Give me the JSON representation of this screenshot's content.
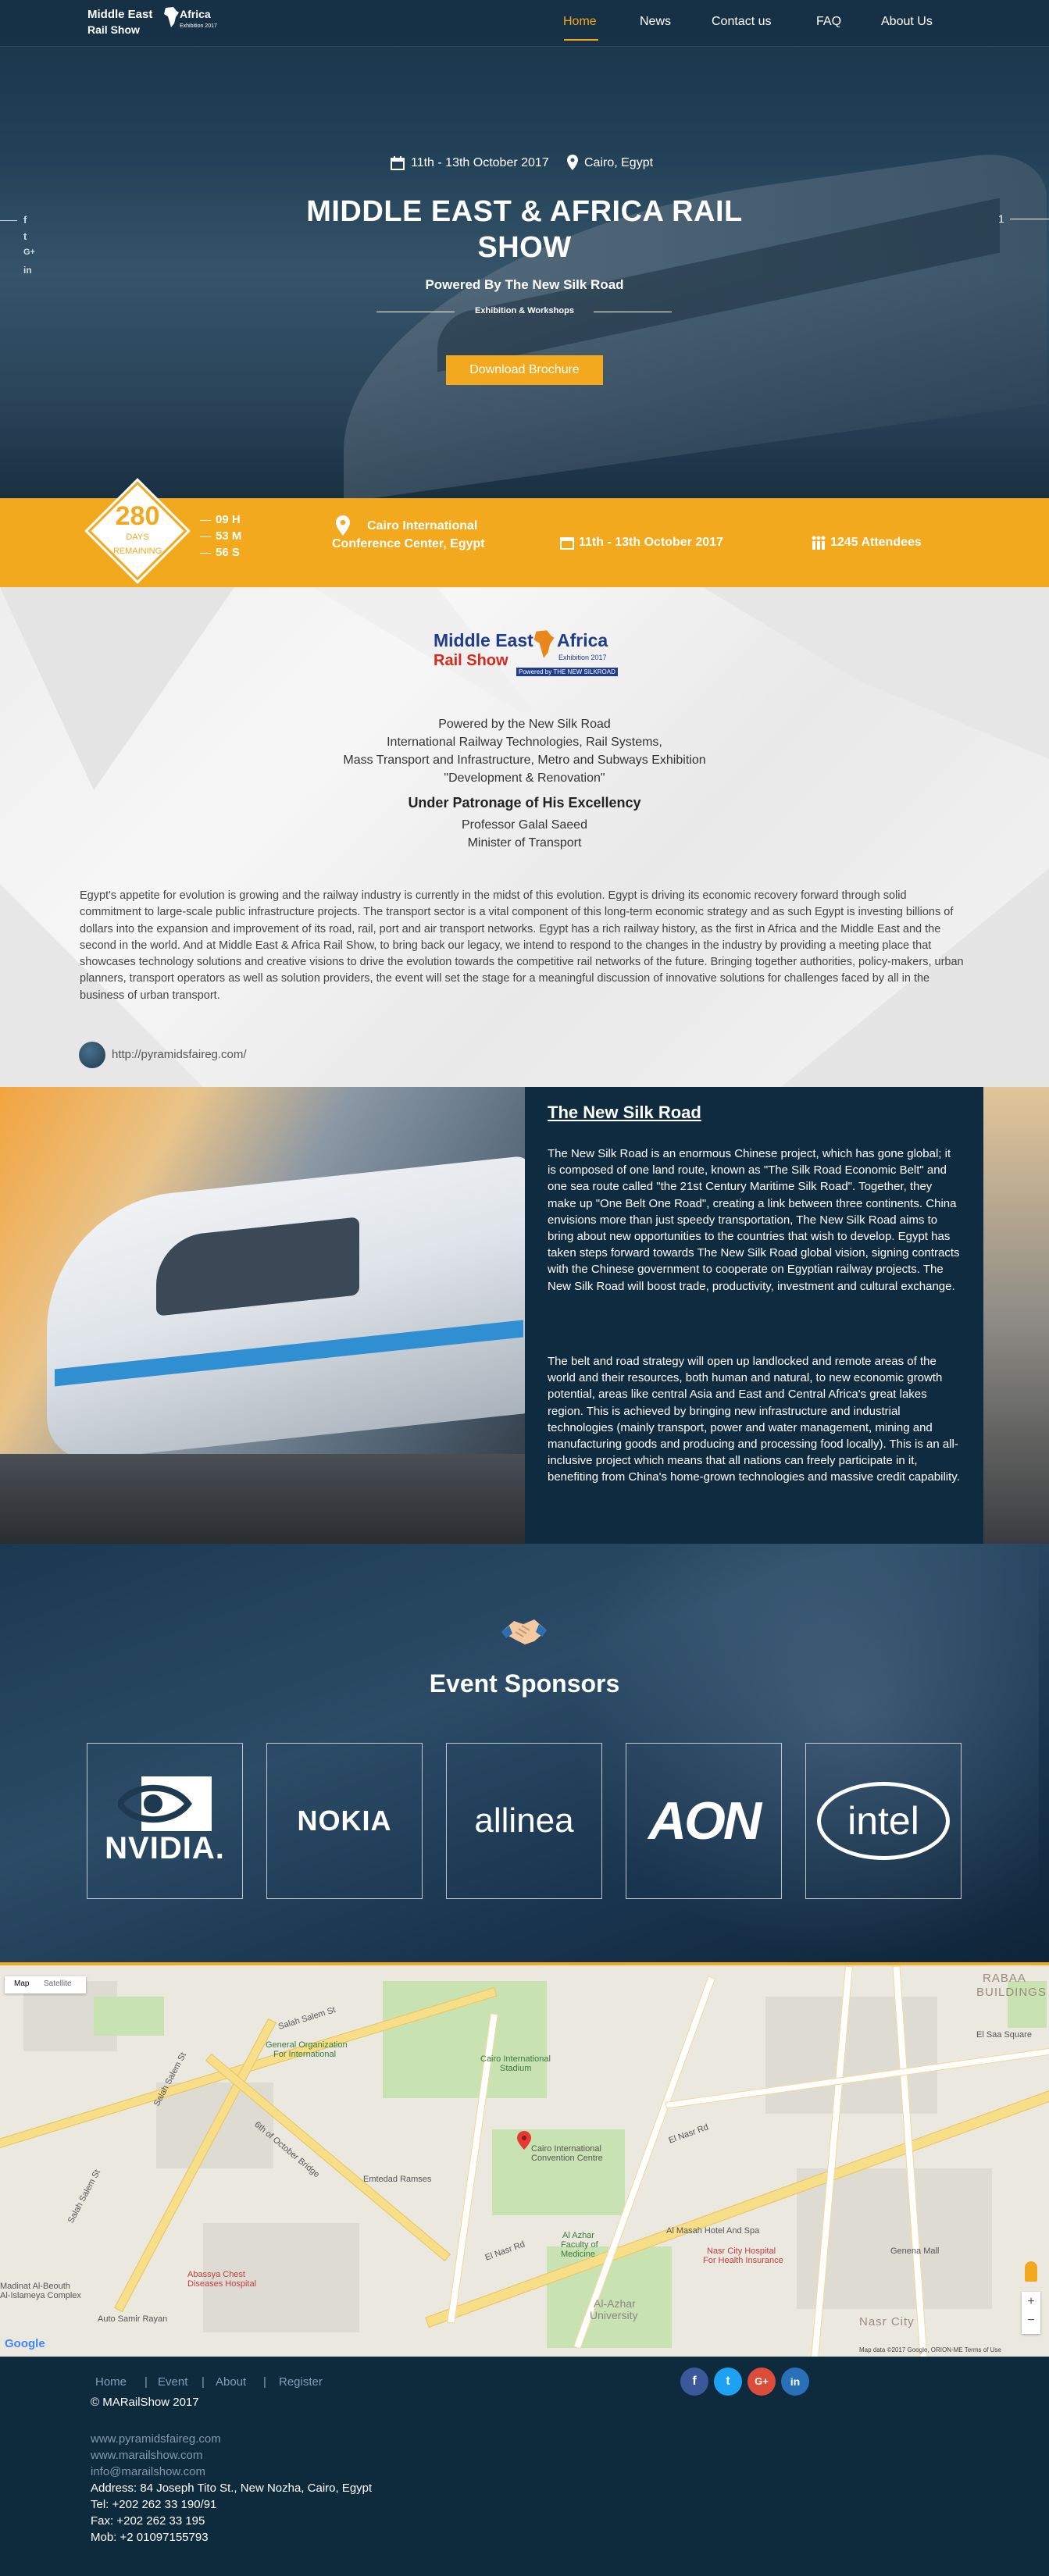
{
  "header": {
    "logo": {
      "line1": "Middle East",
      "line2": "Rail Show",
      "line3": "Africa",
      "line4": "Exhibition 2017"
    },
    "nav": [
      {
        "label": "Home",
        "active": true
      },
      {
        "label": "News"
      },
      {
        "label": "Contact us"
      },
      {
        "label": "FAQ"
      },
      {
        "label": "About Us"
      }
    ]
  },
  "hero": {
    "date": "11th - 13th October 2017",
    "location": "Cairo, Egypt",
    "title_line1": "MIDDLE EAST & AFRICA RAIL",
    "title_line2": "SHOW",
    "subtitle": "Powered By The New Silk Road",
    "exhibition": "Exhibition & Workshops",
    "button": "Download Brochure",
    "slide_number": "1",
    "social": [
      "f",
      "t",
      "G+",
      "in"
    ]
  },
  "info_bar": {
    "days": "280",
    "days_label1": "DAYS",
    "days_label2": "REMAINING",
    "hours": "09 H",
    "minutes": "53 M",
    "seconds": "56 S",
    "venue_line1": "Cairo International",
    "venue_line2": "Conference Center, Egypt",
    "date": "11th - 13th October 2017",
    "attendees": "1245 Attendees"
  },
  "about": {
    "logo": {
      "line1": "Middle East",
      "line2": "Rail Show",
      "line3": "Africa",
      "line4": "Exhibition 2017",
      "line5": "Powered by THE NEW SILKROAD"
    },
    "lines": [
      "Powered by the New Silk Road",
      "International Railway Technologies, Rail Systems,",
      "Mass Transport and Infrastructure, Metro and Subways Exhibition",
      "\"Development & Renovation\""
    ],
    "patronage": "Under Patronage of His Excellency",
    "person": "Professor Galal Saeed",
    "role": "Minister of Transport",
    "paragraph": "Egypt's appetite for evolution is growing and the railway industry is currently in the midst of this evolution. Egypt is driving its economic recovery forward through solid commitment to large-scale public infrastructure projects. The transport sector is a vital component of this long-term economic strategy and as such Egypt is investing billions of dollars into the expansion and improvement of its road, rail, port and air transport networks. Egypt has a rich railway history, as the first in Africa and the Middle East and the second in the world. And at Middle East & Africa Rail Show, to bring back our legacy, we intend to respond to the changes in the industry by providing a meeting place that showcases technology solutions and creative visions to drive the evolution towards the competitive rail networks of the future. Bringing together authorities, policy-makers, urban planners, transport operators as well as solution providers, the event will set the stage for a meaningful discussion of innovative solutions for challenges faced by all in the business of urban transport.",
    "link": "http://pyramidsfaireg.com/"
  },
  "silk_road": {
    "title": "The New Silk Road",
    "p1": "The New Silk Road is an enormous Chinese project, which has gone global; it is composed of one land route, known as \"The Silk Road Economic Belt\" and one sea route called \"the 21st Century Maritime Silk Road\". Together, they make up \"One Belt One Road\", creating a link between three continents. China envisions more than just speedy transportation, The New Silk Road aims to bring about new opportunities to the countries that wish to develop. Egypt has taken steps forward towards The New Silk Road global vision, signing contracts with the Chinese government to cooperate on Egyptian railway projects. The New Silk Road will boost trade, productivity, investment and cultural exchange.",
    "p2": "The belt and road strategy will open up landlocked and remote areas of the world and their resources, both human and natural, to new economic growth potential, areas like central Asia and East and Central Africa's great lakes region. This is achieved by bringing new infrastructure and industrial technologies (mainly transport, power and water management, mining and manufacturing goods and producing and processing food locally). This is an all-inclusive project which means that all nations can freely participate in it, benefiting from China's home-grown technologies and massive credit capability."
  },
  "sponsors": {
    "title": "Event Sponsors",
    "items": [
      "NVIDIA.",
      "NOKIA",
      "allinea",
      "AON",
      "intel"
    ]
  },
  "map": {
    "type_map": "Map",
    "type_satellite": "Satellite",
    "labels": {
      "salah1": "Salah Salem St",
      "salah2": "Salah Salem St",
      "salah3": "Salah Salem St",
      "org": "General Organization",
      "org2": "For International",
      "stadium": "Cairo International",
      "stadium2": "Stadium",
      "convention": "Cairo International",
      "convention2": "Convention Centre",
      "nasr": "El Nasr Rd",
      "nasr2": "El Nasr Rd",
      "oct": "6th of October Bridge",
      "emtedad": "Emtedad Ramses",
      "azhar": "Al Azhar",
      "azhar2": "Faculty of",
      "azhar3": "Medicine",
      "azharu": "Al-Azhar",
      "azharu2": "University",
      "masah": "Al Masah Hotel And Spa",
      "ncity": "Nasr City Hospital",
      "ncity2": "For Health Insurance",
      "abassya": "Abassya Chest",
      "abassya2": "Diseases Hospital",
      "nasrcity": "Nasr City",
      "rabaa": "RABAA",
      "rabaa2": "BUILDINGS",
      "elsaa": "El Saa Square",
      "genena": "Genena Mall",
      "madinat": "Madinat Al-Beouth",
      "madinat2": "Al-Islameya Complex",
      "auto": "Auto Samir Rayan",
      "google": "Google",
      "footer": "Map data ©2017 Google, ORION-ME   Terms of Use"
    }
  },
  "footer": {
    "links": [
      "Home",
      "Event",
      "About",
      "Register"
    ],
    "copyright": "© MARailShow 2017",
    "site1": "www.pyramidsfaireg.com",
    "site2": "www.marailshow.com",
    "email": "info@marailshow.com",
    "address": "Address: 84 Joseph Tito St., New Nozha, Cairo, Egypt",
    "tel": "Tel: +202 262 33 190/91",
    "fax": "Fax: +202 262 33 195",
    "mob": "Mob: +2 01097155793",
    "social": [
      "f",
      "t",
      "G+",
      "in"
    ],
    "colors": {
      "facebook": "#3b5998",
      "twitter": "#1da1f2",
      "google": "#dd4b39",
      "linkedin": "#2a70b8"
    }
  },
  "colors": {
    "accent": "#f3a91d",
    "dark": "#0e2a3d"
  }
}
